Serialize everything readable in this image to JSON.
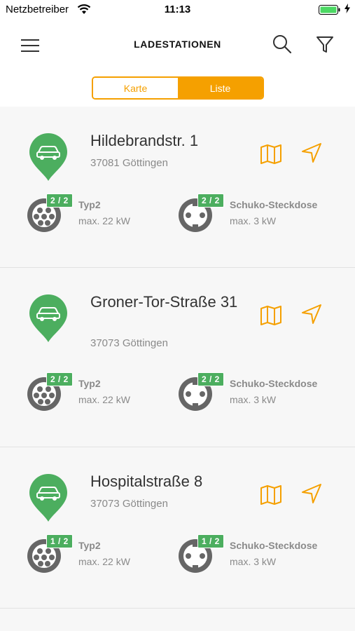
{
  "status_bar": {
    "carrier": "Netzbetreiber",
    "time": "11:13",
    "wifi_icon": "wifi-icon",
    "battery_icon": "battery-icon",
    "battery_color": "#4cd964"
  },
  "header": {
    "title": "LADESTATIONEN",
    "menu_icon": "hamburger-menu-icon",
    "search_icon": "search-icon",
    "filter_icon": "filter-funnel-icon"
  },
  "segment": {
    "tabs": [
      {
        "label": "Karte",
        "active": false
      },
      {
        "label": "Liste",
        "active": true
      }
    ]
  },
  "colors": {
    "accent": "#f5a000",
    "green": "#4cae5f",
    "text_muted": "#8a8a8a"
  },
  "stations": [
    {
      "street": "Hildebrandstr. 1",
      "city": "37081 Göttingen",
      "connectors": [
        {
          "name": "Typ2",
          "power": "max. 22 kW",
          "availability": "2 / 2",
          "icon": "type2-plug-icon"
        },
        {
          "name": "Schuko-Steckdose",
          "power": "max. 3 kW",
          "availability": "2 / 2",
          "icon": "schuko-socket-icon"
        }
      ]
    },
    {
      "street": "Groner-Tor-Straße 31",
      "city": "37073 Göttingen",
      "connectors": [
        {
          "name": "Typ2",
          "power": "max. 22 kW",
          "availability": "2 / 2",
          "icon": "type2-plug-icon"
        },
        {
          "name": "Schuko-Steckdose",
          "power": "max. 3 kW",
          "availability": "2 / 2",
          "icon": "schuko-socket-icon"
        }
      ]
    },
    {
      "street": "Hospitalstraße 8",
      "city": "37073 Göttingen",
      "connectors": [
        {
          "name": "Typ2",
          "power": "max. 22 kW",
          "availability": "1 / 2",
          "icon": "type2-plug-icon"
        },
        {
          "name": "Schuko-Steckdose",
          "power": "max. 3 kW",
          "availability": "1 / 2",
          "icon": "schuko-socket-icon"
        }
      ]
    }
  ]
}
